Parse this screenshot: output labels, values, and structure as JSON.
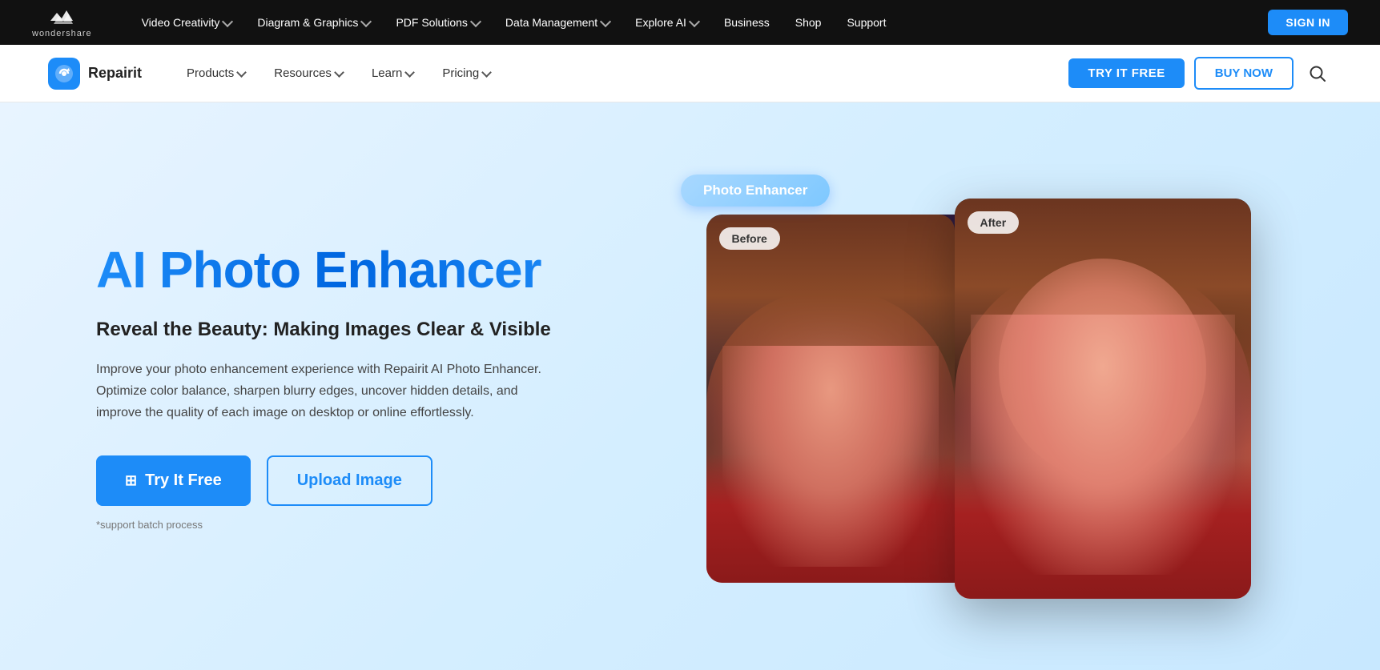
{
  "topNav": {
    "logo": {
      "icon_symbol": "❖",
      "name": "wondershare"
    },
    "items": [
      {
        "label": "Video Creativity",
        "has_dropdown": true
      },
      {
        "label": "Diagram & Graphics",
        "has_dropdown": true
      },
      {
        "label": "PDF Solutions",
        "has_dropdown": true
      },
      {
        "label": "Data Management",
        "has_dropdown": true
      },
      {
        "label": "Explore AI",
        "has_dropdown": true
      },
      {
        "label": "Business",
        "has_dropdown": false
      },
      {
        "label": "Shop",
        "has_dropdown": false
      },
      {
        "label": "Support",
        "has_dropdown": false
      }
    ],
    "signin_label": "SIGN IN"
  },
  "secNav": {
    "logo_name": "Repairit",
    "logo_icon": "↻",
    "items": [
      {
        "label": "Products",
        "has_dropdown": true
      },
      {
        "label": "Resources",
        "has_dropdown": true
      },
      {
        "label": "Learn",
        "has_dropdown": true
      },
      {
        "label": "Pricing",
        "has_dropdown": true
      }
    ],
    "try_free_label": "TRY IT FREE",
    "buy_now_label": "BUY NOW",
    "search_placeholder": "Search..."
  },
  "hero": {
    "title": "AI Photo Enhancer",
    "subtitle": "Reveal the Beauty: Making Images Clear & Visible",
    "description": "Improve your photo enhancement experience with Repairit AI Photo Enhancer. Optimize color balance, sharpen blurry edges, uncover hidden details, and improve the quality of each image on desktop or online effortlessly.",
    "try_it_free_label": "Try It Free",
    "upload_image_label": "Upload Image",
    "note": "*support batch process",
    "photo_enhancer_badge": "Photo Enhancer",
    "label_before": "Before",
    "label_after": "After"
  }
}
